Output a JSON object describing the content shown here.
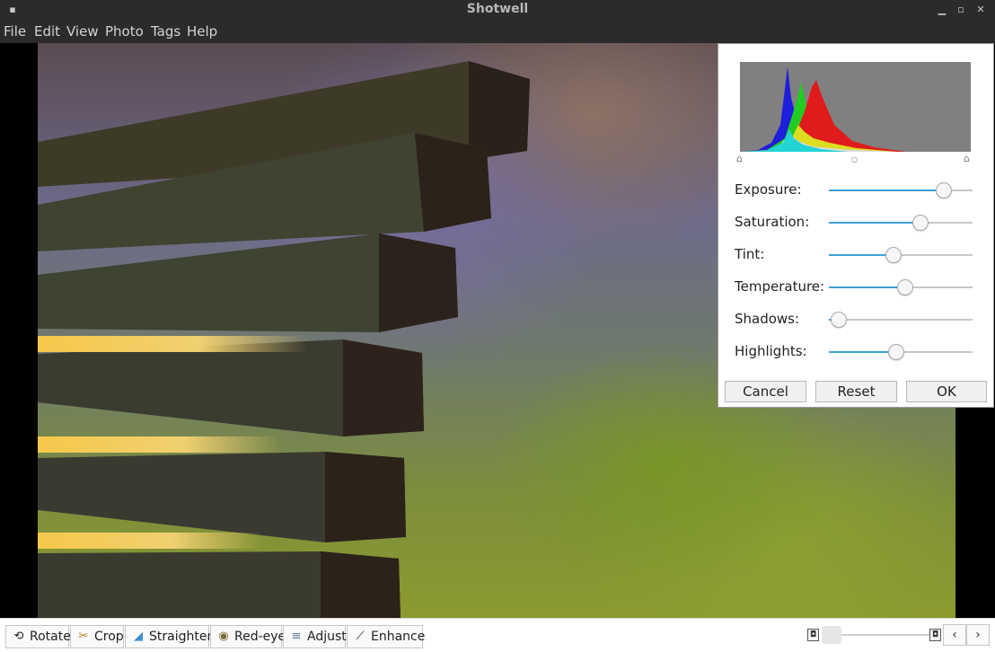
{
  "window": {
    "title": "Shotwell"
  },
  "menu": [
    "File",
    "Edit",
    "View",
    "Photo",
    "Tags",
    "Help"
  ],
  "icons": {
    "app": "app-menu-icon",
    "minimize": "minimize-icon",
    "maximize": "maximize-icon",
    "close": "close-icon"
  },
  "adjust": {
    "sliders": [
      {
        "label": "Exposure:",
        "value": 0.8
      },
      {
        "label": "Saturation:",
        "value": 0.64
      },
      {
        "label": "Tint:",
        "value": 0.45
      },
      {
        "label": "Temperature:",
        "value": 0.53
      },
      {
        "label": "Shadows:",
        "value": 0.07
      },
      {
        "label": "Highlights:",
        "value": 0.47
      }
    ],
    "buttons": {
      "cancel": "Cancel",
      "reset": "Reset",
      "ok": "OK"
    }
  },
  "toolbar": {
    "tools": [
      {
        "label": "Rotate",
        "icon": "rotate-icon"
      },
      {
        "label": "Crop",
        "icon": "crop-icon"
      },
      {
        "label": "Straighten",
        "icon": "straighten-icon"
      },
      {
        "label": "Red-eye",
        "icon": "red-eye-icon"
      },
      {
        "label": "Adjust",
        "icon": "adjust-icon"
      },
      {
        "label": "Enhance",
        "icon": "enhance-icon"
      }
    ],
    "zoom_level": 0.0
  },
  "colors": {
    "accent": "#3fa0d6",
    "titlebar": "#2b2b2b"
  }
}
